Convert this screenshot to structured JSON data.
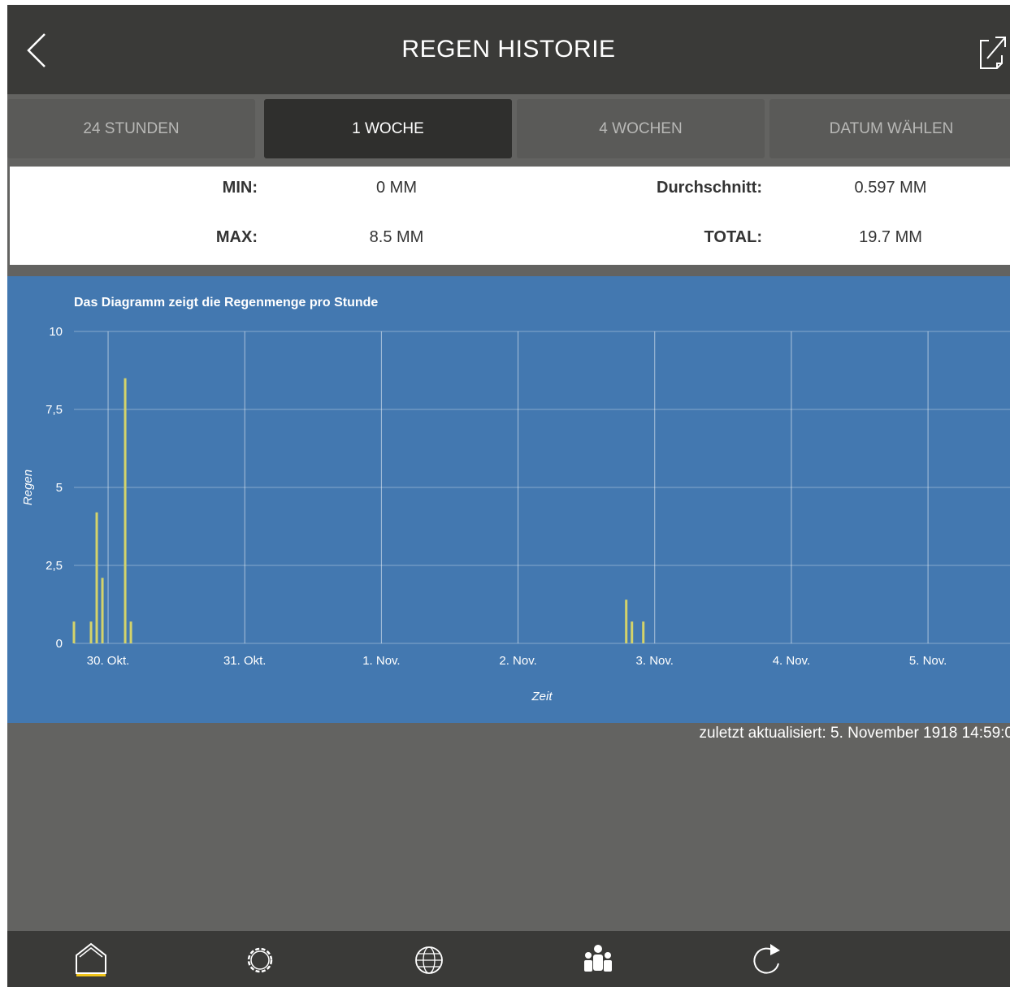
{
  "header": {
    "title": "REGEN HISTORIE",
    "back_icon": "chevron-left-icon",
    "export_icon": "external-link-icon"
  },
  "tabs": [
    {
      "label": "24 STUNDEN",
      "active": false
    },
    {
      "label": "1 WOCHE",
      "active": true
    },
    {
      "label": "4 WOCHEN",
      "active": false
    },
    {
      "label": "DATUM WÄHLEN",
      "active": false
    }
  ],
  "stats": {
    "min_label": "MIN:",
    "min_value": "0 MM",
    "avg_label": "Durchschnitt:",
    "avg_value": "0.597 MM",
    "max_label": "MAX:",
    "max_value": "8.5 MM",
    "total_label": "TOTAL:",
    "total_value": "19.7 MM"
  },
  "chart_data": {
    "type": "bar",
    "title": "Das Diagramm zeigt die Regenmenge pro Stunde",
    "xlabel": "Zeit",
    "ylabel": "Regen",
    "x_ticks": [
      "30. Okt.",
      "31. Okt.",
      "1. Nov.",
      "2. Nov.",
      "3. Nov.",
      "4. Nov.",
      "5. Nov."
    ],
    "y_ticks": [
      "0",
      "2,5",
      "5",
      "7,5",
      "10"
    ],
    "ylim": [
      0,
      10
    ],
    "xlim_days_from_30_okt": [
      -0.25,
      6.6
    ],
    "grid": true,
    "bar_color": "#d4d36a",
    "background": "#4378b0",
    "series": [
      {
        "points": [
          {
            "x": "29. Okt. 18:00",
            "y": 0.7
          },
          {
            "x": "29. Okt. 21:00",
            "y": 0.7
          },
          {
            "x": "29. Okt. 22:00",
            "y": 4.2
          },
          {
            "x": "29. Okt. 23:00",
            "y": 2.1
          },
          {
            "x": "30. Okt. 03:00",
            "y": 8.5
          },
          {
            "x": "30. Okt. 04:00",
            "y": 0.7
          },
          {
            "x": "2. Nov. 19:00",
            "y": 1.4
          },
          {
            "x": "2. Nov. 20:00",
            "y": 0.7
          },
          {
            "x": "2. Nov. 22:00",
            "y": 0.7
          }
        ]
      }
    ]
  },
  "footer": {
    "updated_text": "zuletzt aktualisiert: 5. November 1918 14:59:0",
    "nav_items": [
      {
        "icon": "home-icon",
        "active": true
      },
      {
        "icon": "gear-icon",
        "active": false
      },
      {
        "icon": "globe-icon",
        "active": false
      },
      {
        "icon": "people-icon",
        "active": false
      },
      {
        "icon": "refresh-icon",
        "active": false
      }
    ]
  }
}
